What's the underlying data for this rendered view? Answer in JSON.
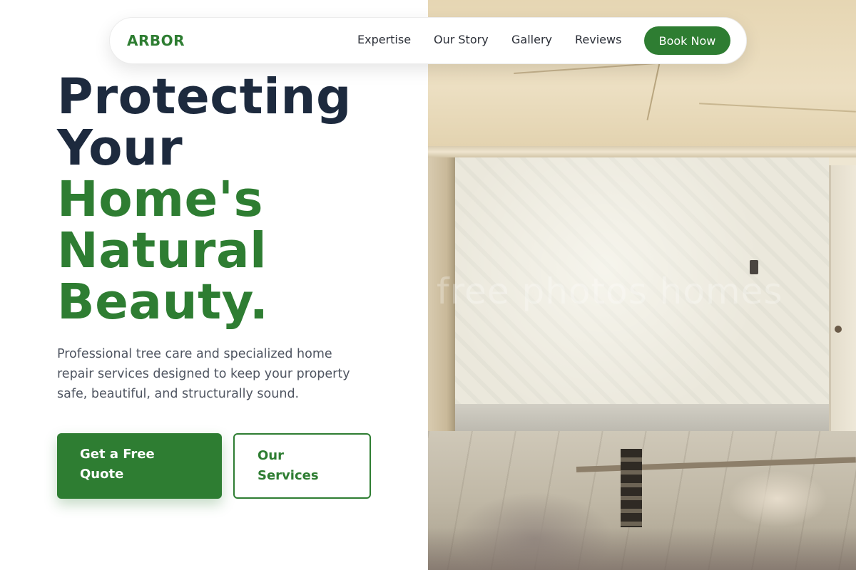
{
  "nav": {
    "brand": "ARBOR",
    "links": [
      "Expertise",
      "Our Story",
      "Gallery",
      "Reviews"
    ],
    "cta": "Book Now"
  },
  "hero": {
    "headline_dark": [
      "Protecting",
      "Your"
    ],
    "headline_green": [
      "Home's",
      "Natural",
      "Beauty."
    ],
    "description": "Professional tree care and specialized home repair services designed to keep your property safe, beautiful, and structurally sound.",
    "primary_button": "Get a Free Quote",
    "secondary_button": "Our Services",
    "image_watermark": "free photos homes"
  },
  "colors": {
    "brand_green": "#2e7d32",
    "headline_dark": "#1d2a3e",
    "body_text": "#4f5561"
  },
  "icons": []
}
